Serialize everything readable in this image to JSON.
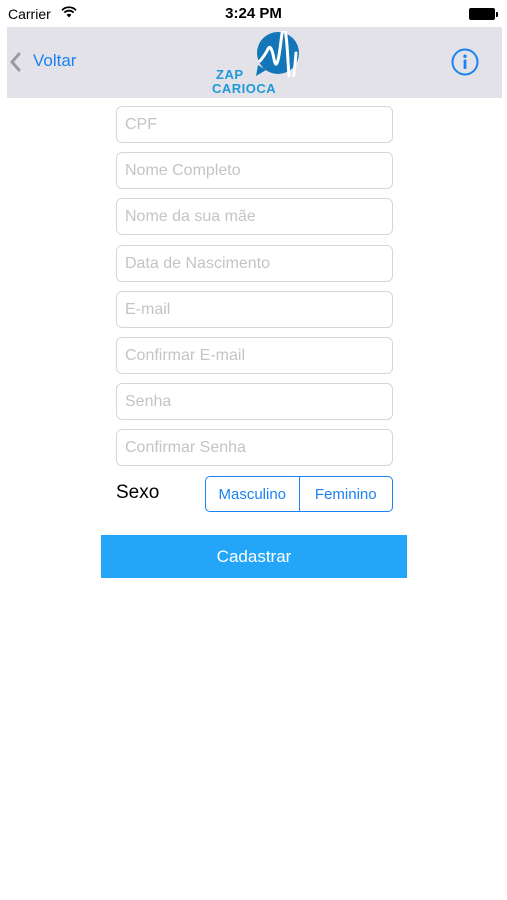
{
  "status_bar": {
    "carrier": "Carrier",
    "time": "3:24 PM",
    "wifi_icon": "wifi-icon",
    "battery_icon": "battery-icon"
  },
  "nav": {
    "back_label": "Voltar",
    "back_icon": "chevron-left-icon",
    "logo_text_1": "ZAP",
    "logo_text_2": "CARIOCA",
    "info_icon": "info-icon",
    "accent_color": "#1a82f2"
  },
  "form": {
    "fields": [
      {
        "placeholder": "CPF",
        "value": ""
      },
      {
        "placeholder": "Nome Completo",
        "value": ""
      },
      {
        "placeholder": "Nome da sua mãe",
        "value": ""
      },
      {
        "placeholder": "Data de Nascimento",
        "value": ""
      },
      {
        "placeholder": "E-mail",
        "value": ""
      },
      {
        "placeholder": "Confirmar E-mail",
        "value": ""
      },
      {
        "placeholder": "Senha",
        "value": ""
      },
      {
        "placeholder": "Confirmar Senha",
        "value": ""
      }
    ],
    "sexo_label": "Sexo",
    "sexo_options": [
      "Masculino",
      "Feminino"
    ],
    "submit_label": "Cadastrar",
    "submit_color": "#23a6f7"
  }
}
